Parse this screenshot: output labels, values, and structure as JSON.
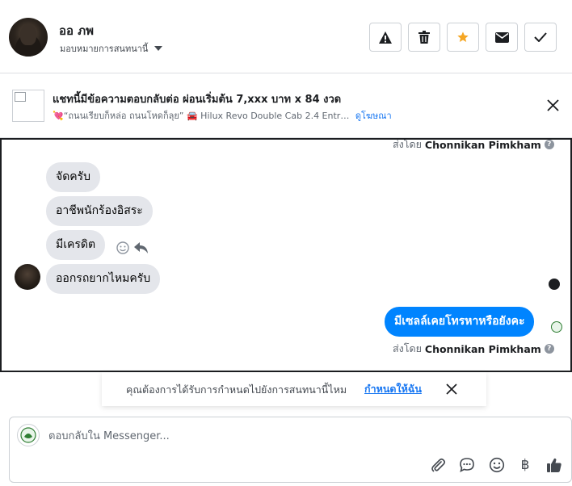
{
  "header": {
    "name": "ออ ภพ",
    "assign_label": "มอบหมายการสนทนานี้",
    "actions": [
      {
        "icon": "warning-icon"
      },
      {
        "icon": "trash-icon"
      },
      {
        "icon": "star-icon",
        "color": "#f5a623"
      },
      {
        "icon": "envelope-icon"
      },
      {
        "icon": "check-icon"
      }
    ]
  },
  "ad": {
    "title": "แชทนี้มีข้อความตอบกลับต่อ ผ่อนเริ่มต้น 7,xxx บาท x 84 งวด",
    "description": "💘“ถนนเรียบก็หล่อ ถนนโหดก็ลุย” 🚘 Hilux Revo Double Cab 2.4 Entr…",
    "view_ad_link": "ดูโฆษณา"
  },
  "chat": {
    "sent_by_prefix": "ส่งโดย",
    "sent_by_name": "Chonnikan Pimkham",
    "incoming": [
      "จัดครับ",
      "อาชีพนักร้องอิสระ",
      "มีเครดิต",
      "ออกรถยากไหมครับ"
    ],
    "outgoing": "มีเซลล์เคยโทรหาหรือยังคะ"
  },
  "followup": {
    "question": "คุณต้องการได้รับการกำหนดไปยังการสนทนานี้ไหม",
    "action": "กำหนดให้ฉัน"
  },
  "composer": {
    "placeholder": "ตอบกลับใน Messenger...",
    "baht_symbol": "฿"
  },
  "colors": {
    "accent": "#0084ff",
    "link": "#1877f2",
    "star": "#f5a623"
  }
}
